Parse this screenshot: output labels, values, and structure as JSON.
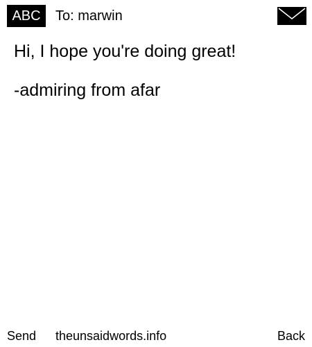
{
  "header": {
    "input_mode": "ABC",
    "recipient": "To: marwin",
    "envelope_icon": "envelope-icon"
  },
  "message": {
    "lines": [
      "Hi, I hope you're doing great!",
      "-admiring from afar"
    ]
  },
  "footer": {
    "left_label": "Send",
    "center_label": "theunsaidwords.info",
    "right_label": "Back"
  },
  "colors": {
    "background": "#ffffff",
    "foreground": "#000000"
  }
}
